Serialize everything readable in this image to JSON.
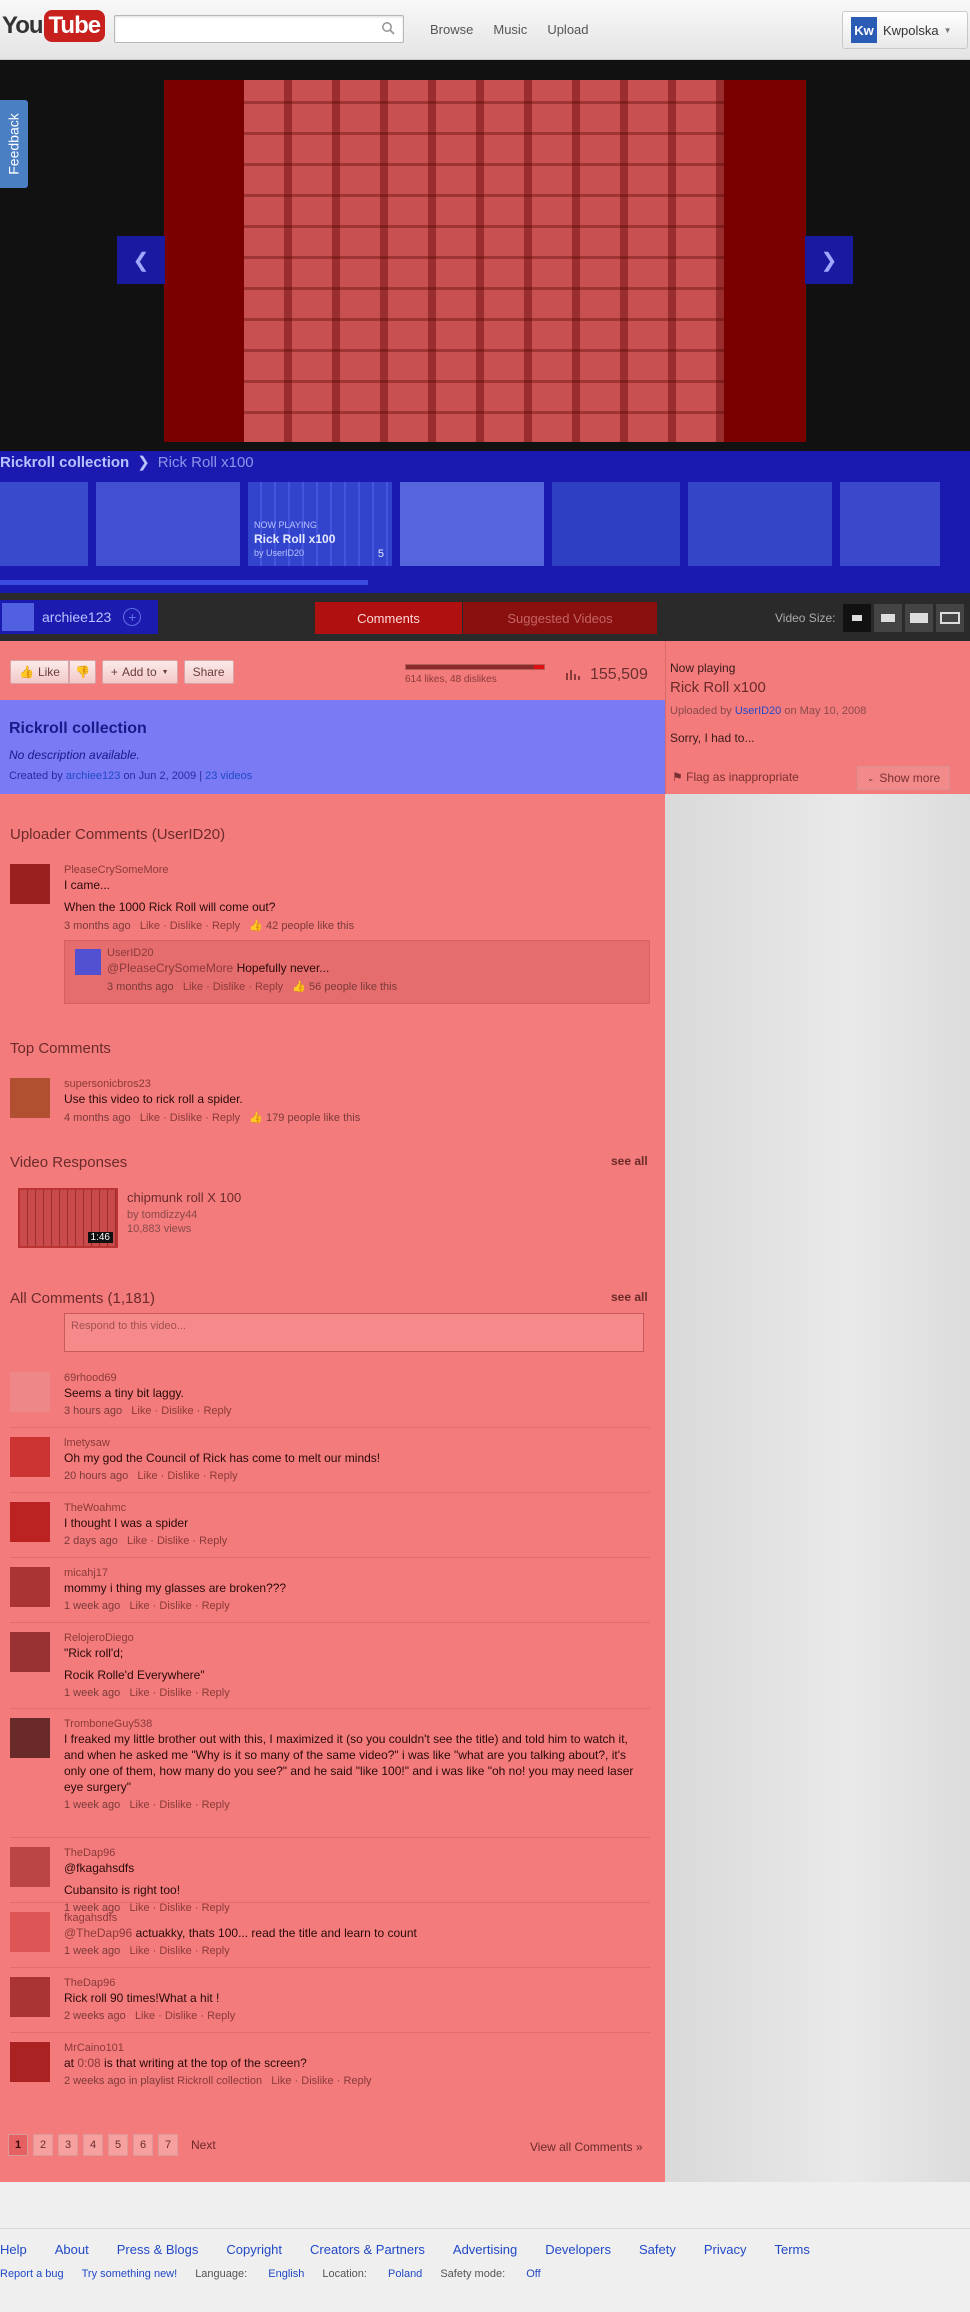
{
  "header": {
    "logo_you": "You",
    "logo_tube": "Tube",
    "nav": [
      "Browse",
      "Music",
      "Upload"
    ],
    "user": "Kwpolska",
    "user_initials": "Kw"
  },
  "feedback": "Feedback",
  "playlist": {
    "name": "Rickroll collection",
    "current": "Rick Roll x100",
    "now_playing_label": "NOW PLAYING",
    "now_playing_title": "Rick Roll x100",
    "now_playing_by": "by UserID20",
    "now_playing_index": "5"
  },
  "owner": {
    "name": "archiee123"
  },
  "tabs": {
    "comments": "Comments",
    "suggested": "Suggested Videos",
    "video_size": "Video Size:"
  },
  "actions": {
    "like": "Like",
    "add_to": "Add to",
    "share": "Share",
    "ratings": "614 likes, 48 dislikes",
    "likes_fraction": 0.927,
    "views": "155,509"
  },
  "sidebar": {
    "now_playing": "Now playing",
    "title": "Rick Roll x100",
    "uploaded_prefix": "Uploaded by",
    "uploader": "UserID20",
    "uploaded_suffix": "on May 10, 2008",
    "desc": "Sorry, I had to...",
    "flag": "Flag as inappropriate",
    "show_more": "Show more"
  },
  "plinfo": {
    "title": "Rickroll collection",
    "desc": "No description available.",
    "created_prefix": "Created by",
    "creator": "archiee123",
    "created_date": "on Jun 2, 2009 |",
    "videos": "23 videos"
  },
  "uploader_comments": {
    "heading": "Uploader Comments (UserID20)",
    "c1": {
      "user": "PleaseCrySomeMore",
      "line1": "I came...",
      "line2": "When the 1000 Rick Roll will come out?",
      "time": "3 months ago",
      "likes": "42 people like this"
    },
    "reply": {
      "user": "UserID20",
      "mention": "@PleaseCrySomeMore",
      "text": "Hopefully never...",
      "time": "3 months ago",
      "likes": "56 people like this"
    }
  },
  "top_comments": {
    "heading": "Top Comments",
    "c1": {
      "user": "supersonicbros23",
      "text": "Use this video to rick roll a spider.",
      "time": "4 months ago",
      "likes": "179 people like this"
    }
  },
  "video_responses": {
    "heading": "Video Responses",
    "see_all": "see all",
    "title": "chipmunk roll X 100",
    "by": "by tomdizzy44",
    "views": "10,883 views",
    "duration": "1:46"
  },
  "all_comments": {
    "heading": "All Comments (1,181)",
    "see_all": "see all",
    "placeholder": "Respond to this video...",
    "items": [
      {
        "user": "69rhood69",
        "text": "Seems a tiny bit laggy.",
        "time": "3 hours ago"
      },
      {
        "user": "lmetysaw",
        "text": "Oh my god the Council of Rick has come to melt our minds!",
        "time": "20 hours ago"
      },
      {
        "user": "TheWoahmc",
        "text": "I thought I was a spider",
        "time": "2 days ago"
      },
      {
        "user": "micahj17",
        "text": "mommy i thing my glasses are broken???",
        "time": "1 week ago"
      },
      {
        "user": "RelojeroDiego",
        "text": "\"Rick roll'd;",
        "text2": "Rocik Rolle'd Everywhere\"",
        "time": "1 week ago"
      },
      {
        "user": "TromboneGuy538",
        "text": "I freaked my little brother out with this, I maximized it (so you couldn't see the title) and told him to watch it, and when he asked me \"Why is it so many of the same video?\" i was like \"what are you talking about?, it's only one of them, how many do you see?\" and he said \"like 100!\" and i was like \"oh no! you may need laser eye surgery\"",
        "time": "1 week ago"
      },
      {
        "user": "TheDap96",
        "text": "@fkagahsdfs",
        "text2": "Cubansito is right too!",
        "time": "1 week ago"
      },
      {
        "user": "fkagahsdfs",
        "mention": "@TheDap96",
        "text": "actuakky, thats 100... read the title and learn to count",
        "time": "1 week ago"
      },
      {
        "user": "TheDap96",
        "text": "Rick roll 90 times!What a hit !",
        "time": "2 weeks ago"
      },
      {
        "user": "MrCaino101",
        "pre": "at",
        "time_link": "0:08",
        "text": "is that writing at the top of the screen?",
        "time": "2 weeks ago in playlist",
        "playlist_link": "Rickroll collection"
      }
    ],
    "like": "Like",
    "dislike": "Dislike",
    "reply": "Reply",
    "sep": " · "
  },
  "pager": {
    "pages": [
      "1",
      "2",
      "3",
      "4",
      "5",
      "6",
      "7"
    ],
    "next": "Next",
    "view_all": "View all Comments »"
  },
  "footer": {
    "links": [
      "Help",
      "About",
      "Press & Blogs",
      "Copyright",
      "Creators & Partners",
      "Advertising",
      "Developers",
      "Safety",
      "Privacy",
      "Terms"
    ],
    "report": "Report a bug",
    "try": "Try something new!",
    "lang_label": "Language:",
    "lang": "English",
    "loc_label": "Location:",
    "loc": "Poland",
    "safe_label": "Safety mode:",
    "safe": "Off"
  }
}
